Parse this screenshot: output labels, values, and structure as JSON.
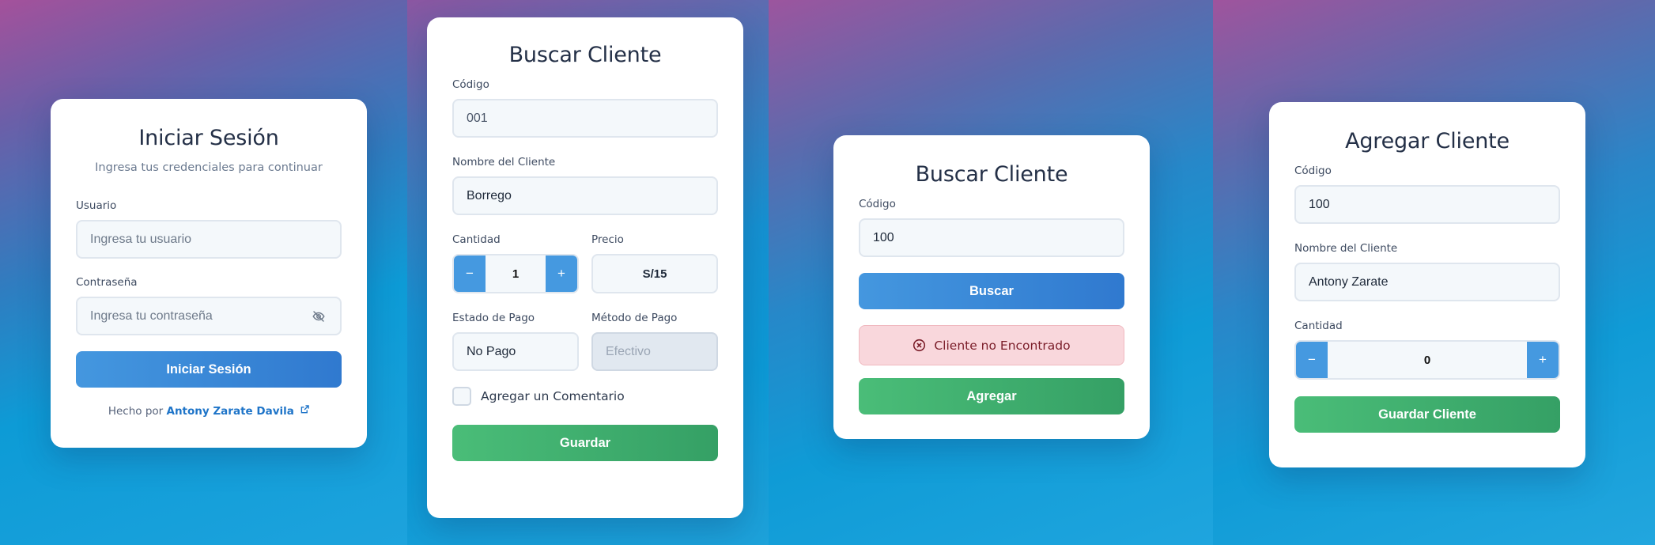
{
  "login": {
    "title": "Iniciar Sesión",
    "subtitle": "Ingresa tus credenciales para continuar",
    "user_label": "Usuario",
    "user_placeholder": "Ingresa tu usuario",
    "pass_label": "Contraseña",
    "pass_placeholder": "Ingresa tu contraseña",
    "submit_label": "Iniciar Sesión",
    "footer_prefix": "Hecho por",
    "footer_link": "Antony Zarate Davila"
  },
  "search_edit": {
    "title": "Buscar Cliente",
    "code_label": "Código",
    "code_value": "001",
    "name_label": "Nombre del Cliente",
    "name_value": "Borrego",
    "qty_label": "Cantidad",
    "qty_minus": "−",
    "qty_value": "1",
    "qty_plus": "+",
    "price_label": "Precio",
    "price_value": "S/15",
    "pay_status_label": "Estado de Pago",
    "pay_status_value": "No Pago",
    "pay_method_label": "Método de Pago",
    "pay_method_value": "Efectivo",
    "comment_label": "Agregar un Comentario",
    "save_label": "Guardar"
  },
  "search_result": {
    "title": "Buscar Cliente",
    "code_label": "Código",
    "code_value": "100",
    "search_label": "Buscar",
    "alert_text": "Cliente no Encontrado",
    "add_label": "Agregar"
  },
  "add_client": {
    "title": "Agregar Cliente",
    "code_label": "Código",
    "code_value": "100",
    "name_label": "Nombre del Cliente",
    "name_value": "Antony Zarate",
    "qty_label": "Cantidad",
    "qty_minus": "−",
    "qty_value": "0",
    "qty_plus": "+",
    "save_label": "Guardar Cliente"
  },
  "colors": {
    "primary_blue": "#3b8ad8",
    "success_green": "#40ad6d",
    "alert_bg": "#f9d7dc",
    "alert_text": "#7a1c28",
    "title_text": "#243047"
  }
}
